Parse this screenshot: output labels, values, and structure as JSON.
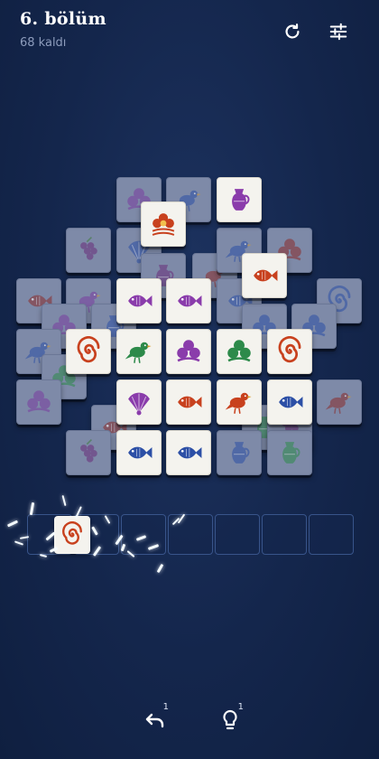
{
  "header": {
    "title": "6. bölüm",
    "remaining": "68 kaldı",
    "restart_icon": "restart-icon",
    "settings_icon": "sliders-icon"
  },
  "colors": {
    "background": "#14264c",
    "tile_free": "#f4f3ee",
    "tile_blocked": "#7e8aa8",
    "flower": "#c8411e",
    "bird": "#2c4fa6",
    "fish": "#8a3cab",
    "spiral": "#c8411e",
    "clover": "#7a3ca0"
  },
  "board": {
    "tiles": [
      {
        "icon": "clover-icon",
        "color": "#7a3ca0",
        "state": "blocked"
      },
      {
        "icon": "bird-icon",
        "color": "#2c4fa6",
        "state": "blocked"
      },
      {
        "icon": "jug-icon",
        "color": "#8a3cab",
        "state": "free"
      },
      {
        "icon": "flower-icon",
        "color": "#c8411e",
        "state": "free"
      },
      {
        "icon": "grapes-icon",
        "color": "#6a2c7a",
        "state": "blocked"
      },
      {
        "icon": "fan-icon",
        "color": "#2c4fa6",
        "state": "blocked"
      },
      {
        "icon": "jug-icon",
        "color": "#6a2c7a",
        "state": "blocked"
      },
      {
        "icon": "bird-icon",
        "color": "#8a2a2a",
        "state": "blocked"
      },
      {
        "icon": "bird-icon",
        "color": "#2c4fa6",
        "state": "blocked"
      },
      {
        "icon": "clover-icon",
        "color": "#8a2a2a",
        "state": "blocked"
      },
      {
        "icon": "fish-icon",
        "color": "#c8411e",
        "state": "free"
      },
      {
        "icon": "fish-icon",
        "color": "#8a2a2a",
        "state": "blocked"
      },
      {
        "icon": "bird-icon",
        "color": "#7a3ca0",
        "state": "blocked"
      },
      {
        "icon": "fish-icon",
        "color": "#8a3cab",
        "state": "free"
      },
      {
        "icon": "fish-icon",
        "color": "#8a3cab",
        "state": "free"
      },
      {
        "icon": "fish-icon",
        "color": "#2c4fa6",
        "state": "blocked"
      },
      {
        "icon": "spiral-icon",
        "color": "#2c4fa6",
        "state": "blocked"
      },
      {
        "icon": "clover-icon",
        "color": "#7a3ca0",
        "state": "blocked"
      },
      {
        "icon": "jug-icon",
        "color": "#2c4fa6",
        "state": "blocked"
      },
      {
        "icon": "clover-icon",
        "color": "#2c4fa6",
        "state": "blocked"
      },
      {
        "icon": "clover-icon",
        "color": "#2c4fa6",
        "state": "blocked"
      },
      {
        "icon": "bird-icon",
        "color": "#2c4fa6",
        "state": "blocked"
      },
      {
        "icon": "spiral-icon",
        "color": "#c8411e",
        "state": "free"
      },
      {
        "icon": "bird-icon",
        "color": "#2d8a4a",
        "state": "free"
      },
      {
        "icon": "clover-icon",
        "color": "#8a3cab",
        "state": "free"
      },
      {
        "icon": "clover-icon",
        "color": "#2d8a4a",
        "state": "free"
      },
      {
        "icon": "spiral-icon",
        "color": "#c8411e",
        "state": "free"
      },
      {
        "icon": "bird-icon",
        "color": "#8a2a2a",
        "state": "blocked"
      },
      {
        "icon": "clover-icon",
        "color": "#2d8a4a",
        "state": "blocked"
      },
      {
        "icon": "clover-icon",
        "color": "#7a3ca0",
        "state": "blocked"
      },
      {
        "icon": "fan-icon",
        "color": "#8a3cab",
        "state": "free"
      },
      {
        "icon": "fish-icon",
        "color": "#c8411e",
        "state": "free"
      },
      {
        "icon": "bird-icon",
        "color": "#c8411e",
        "state": "free"
      },
      {
        "icon": "fish-icon",
        "color": "#2c4fa6",
        "state": "free"
      },
      {
        "icon": "fish-icon",
        "color": "#8a2a2a",
        "state": "blocked"
      },
      {
        "icon": "jug-icon",
        "color": "#2d8a4a",
        "state": "blocked"
      },
      {
        "icon": "grapes-icon",
        "color": "#6a2c7a",
        "state": "blocked"
      },
      {
        "icon": "grapes-icon",
        "color": "#6a2c7a",
        "state": "blocked"
      },
      {
        "icon": "fish-icon",
        "color": "#2c4fa6",
        "state": "free"
      },
      {
        "icon": "fish-icon",
        "color": "#2c4fa6",
        "state": "free"
      },
      {
        "icon": "jug-icon",
        "color": "#2c4fa6",
        "state": "blocked"
      },
      {
        "icon": "jug-icon",
        "color": "#2d8a4a",
        "state": "blocked"
      }
    ]
  },
  "tray": {
    "slot_count": 7,
    "items": [
      {
        "icon": "spiral-icon",
        "color": "#c8411e"
      }
    ]
  },
  "controls": {
    "undo_icon": "undo-icon",
    "undo_count": "1",
    "hint_icon": "lightbulb-icon",
    "hint_count": "1"
  }
}
